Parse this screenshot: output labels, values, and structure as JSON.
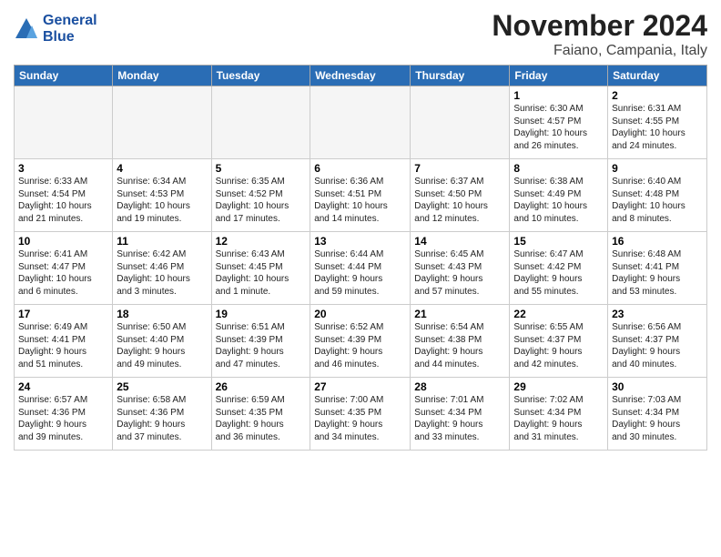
{
  "logo": {
    "line1": "General",
    "line2": "Blue"
  },
  "header": {
    "title": "November 2024",
    "location": "Faiano, Campania, Italy"
  },
  "days_of_week": [
    "Sunday",
    "Monday",
    "Tuesday",
    "Wednesday",
    "Thursday",
    "Friday",
    "Saturday"
  ],
  "weeks": [
    [
      {
        "day": "",
        "info": "",
        "empty": true
      },
      {
        "day": "",
        "info": "",
        "empty": true
      },
      {
        "day": "",
        "info": "",
        "empty": true
      },
      {
        "day": "",
        "info": "",
        "empty": true
      },
      {
        "day": "",
        "info": "",
        "empty": true
      },
      {
        "day": "1",
        "info": "Sunrise: 6:30 AM\nSunset: 4:57 PM\nDaylight: 10 hours\nand 26 minutes.",
        "empty": false
      },
      {
        "day": "2",
        "info": "Sunrise: 6:31 AM\nSunset: 4:55 PM\nDaylight: 10 hours\nand 24 minutes.",
        "empty": false
      }
    ],
    [
      {
        "day": "3",
        "info": "Sunrise: 6:33 AM\nSunset: 4:54 PM\nDaylight: 10 hours\nand 21 minutes.",
        "empty": false
      },
      {
        "day": "4",
        "info": "Sunrise: 6:34 AM\nSunset: 4:53 PM\nDaylight: 10 hours\nand 19 minutes.",
        "empty": false
      },
      {
        "day": "5",
        "info": "Sunrise: 6:35 AM\nSunset: 4:52 PM\nDaylight: 10 hours\nand 17 minutes.",
        "empty": false
      },
      {
        "day": "6",
        "info": "Sunrise: 6:36 AM\nSunset: 4:51 PM\nDaylight: 10 hours\nand 14 minutes.",
        "empty": false
      },
      {
        "day": "7",
        "info": "Sunrise: 6:37 AM\nSunset: 4:50 PM\nDaylight: 10 hours\nand 12 minutes.",
        "empty": false
      },
      {
        "day": "8",
        "info": "Sunrise: 6:38 AM\nSunset: 4:49 PM\nDaylight: 10 hours\nand 10 minutes.",
        "empty": false
      },
      {
        "day": "9",
        "info": "Sunrise: 6:40 AM\nSunset: 4:48 PM\nDaylight: 10 hours\nand 8 minutes.",
        "empty": false
      }
    ],
    [
      {
        "day": "10",
        "info": "Sunrise: 6:41 AM\nSunset: 4:47 PM\nDaylight: 10 hours\nand 6 minutes.",
        "empty": false
      },
      {
        "day": "11",
        "info": "Sunrise: 6:42 AM\nSunset: 4:46 PM\nDaylight: 10 hours\nand 3 minutes.",
        "empty": false
      },
      {
        "day": "12",
        "info": "Sunrise: 6:43 AM\nSunset: 4:45 PM\nDaylight: 10 hours\nand 1 minute.",
        "empty": false
      },
      {
        "day": "13",
        "info": "Sunrise: 6:44 AM\nSunset: 4:44 PM\nDaylight: 9 hours\nand 59 minutes.",
        "empty": false
      },
      {
        "day": "14",
        "info": "Sunrise: 6:45 AM\nSunset: 4:43 PM\nDaylight: 9 hours\nand 57 minutes.",
        "empty": false
      },
      {
        "day": "15",
        "info": "Sunrise: 6:47 AM\nSunset: 4:42 PM\nDaylight: 9 hours\nand 55 minutes.",
        "empty": false
      },
      {
        "day": "16",
        "info": "Sunrise: 6:48 AM\nSunset: 4:41 PM\nDaylight: 9 hours\nand 53 minutes.",
        "empty": false
      }
    ],
    [
      {
        "day": "17",
        "info": "Sunrise: 6:49 AM\nSunset: 4:41 PM\nDaylight: 9 hours\nand 51 minutes.",
        "empty": false
      },
      {
        "day": "18",
        "info": "Sunrise: 6:50 AM\nSunset: 4:40 PM\nDaylight: 9 hours\nand 49 minutes.",
        "empty": false
      },
      {
        "day": "19",
        "info": "Sunrise: 6:51 AM\nSunset: 4:39 PM\nDaylight: 9 hours\nand 47 minutes.",
        "empty": false
      },
      {
        "day": "20",
        "info": "Sunrise: 6:52 AM\nSunset: 4:39 PM\nDaylight: 9 hours\nand 46 minutes.",
        "empty": false
      },
      {
        "day": "21",
        "info": "Sunrise: 6:54 AM\nSunset: 4:38 PM\nDaylight: 9 hours\nand 44 minutes.",
        "empty": false
      },
      {
        "day": "22",
        "info": "Sunrise: 6:55 AM\nSunset: 4:37 PM\nDaylight: 9 hours\nand 42 minutes.",
        "empty": false
      },
      {
        "day": "23",
        "info": "Sunrise: 6:56 AM\nSunset: 4:37 PM\nDaylight: 9 hours\nand 40 minutes.",
        "empty": false
      }
    ],
    [
      {
        "day": "24",
        "info": "Sunrise: 6:57 AM\nSunset: 4:36 PM\nDaylight: 9 hours\nand 39 minutes.",
        "empty": false
      },
      {
        "day": "25",
        "info": "Sunrise: 6:58 AM\nSunset: 4:36 PM\nDaylight: 9 hours\nand 37 minutes.",
        "empty": false
      },
      {
        "day": "26",
        "info": "Sunrise: 6:59 AM\nSunset: 4:35 PM\nDaylight: 9 hours\nand 36 minutes.",
        "empty": false
      },
      {
        "day": "27",
        "info": "Sunrise: 7:00 AM\nSunset: 4:35 PM\nDaylight: 9 hours\nand 34 minutes.",
        "empty": false
      },
      {
        "day": "28",
        "info": "Sunrise: 7:01 AM\nSunset: 4:34 PM\nDaylight: 9 hours\nand 33 minutes.",
        "empty": false
      },
      {
        "day": "29",
        "info": "Sunrise: 7:02 AM\nSunset: 4:34 PM\nDaylight: 9 hours\nand 31 minutes.",
        "empty": false
      },
      {
        "day": "30",
        "info": "Sunrise: 7:03 AM\nSunset: 4:34 PM\nDaylight: 9 hours\nand 30 minutes.",
        "empty": false
      }
    ]
  ]
}
